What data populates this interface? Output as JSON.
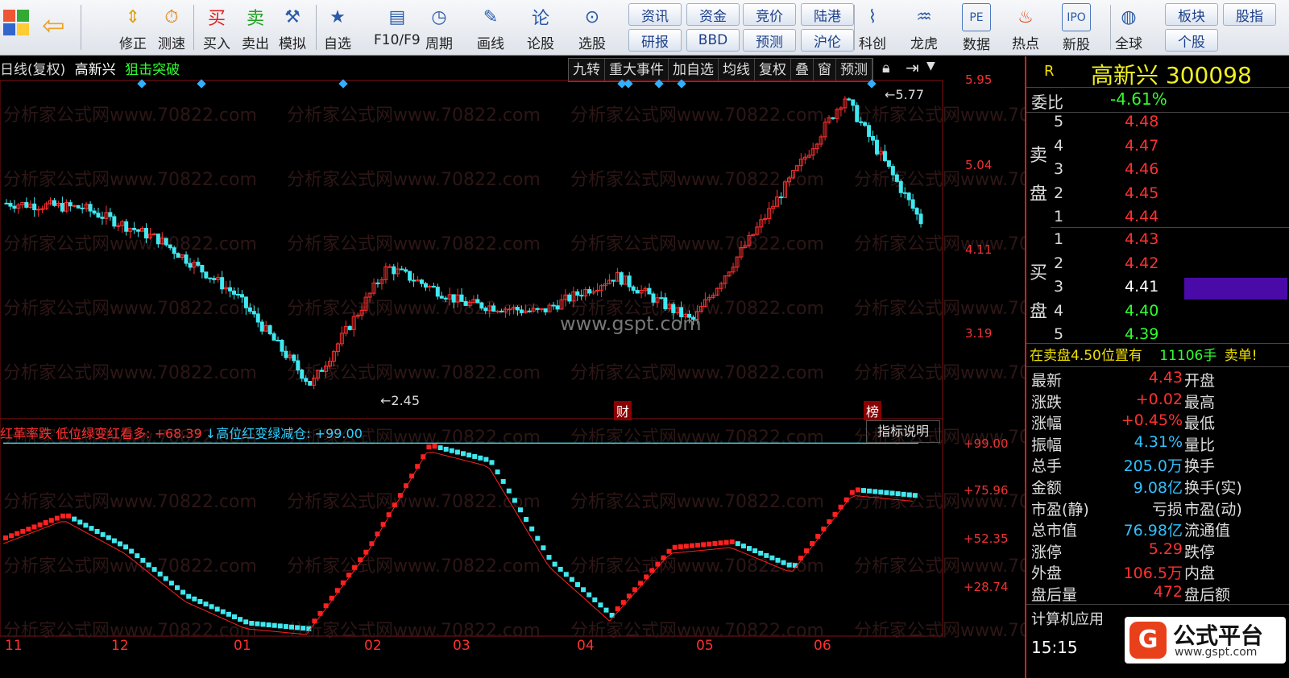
{
  "toolbar": {
    "buttons": [
      {
        "label": "修正",
        "icon": "arrows-updown-icon"
      },
      {
        "label": "测速",
        "icon": "clock-icon"
      },
      {
        "label": "买入",
        "icon": "buy-icon"
      },
      {
        "label": "卖出",
        "icon": "sell-icon"
      },
      {
        "label": "模拟",
        "icon": "hammer-icon"
      },
      {
        "label": "自选",
        "icon": "star-icon"
      },
      {
        "label": "F10/F9",
        "icon": "document-icon"
      },
      {
        "label": "周期",
        "icon": "cycle-icon"
      },
      {
        "label": "画线",
        "icon": "pencil-icon"
      },
      {
        "label": "论股",
        "icon": "discuss-icon"
      },
      {
        "label": "选股",
        "icon": "magnifier-icon"
      },
      {
        "label": "科创",
        "icon": "chart-icon"
      },
      {
        "label": "龙虎",
        "icon": "dragon-icon"
      },
      {
        "label": "数据",
        "icon": "pe-icon"
      },
      {
        "label": "热点",
        "icon": "fire-icon"
      },
      {
        "label": "新股",
        "icon": "ipo-icon"
      },
      {
        "label": "全球",
        "icon": "globe-icon"
      }
    ],
    "pills": [
      "资讯",
      "资金",
      "竞价",
      "陆港",
      "研报",
      "BBD",
      "预测",
      "沪伦",
      "板块",
      "个股",
      "股指"
    ]
  },
  "chart": {
    "header_left": "日线(复权)",
    "stock": "高新兴",
    "signal": "狙击突破",
    "tools": [
      "九转",
      "重大事件",
      "加自选",
      "均线",
      "复权",
      "叠",
      "窗",
      "预测"
    ],
    "price_labels": [
      "5.95",
      "5.04",
      "4.11",
      "3.19"
    ],
    "high_mark": "5.77",
    "low_mark": "2.45",
    "event_marks": [
      "财",
      "榜"
    ],
    "center_watermark": "www.gspt.com",
    "watermark": "分析家公式网www.70822.com"
  },
  "indicator": {
    "formula_text": "红革率跌 低位绿变红看多: +68.39",
    "formula_text2": "↓高位红变绿减仓: +99.00",
    "explain_button": "指标说明",
    "levels": [
      "+99.00",
      "+75.96",
      "+52.35",
      "+28.74"
    ],
    "x_labels": [
      "11",
      "12",
      "01",
      "02",
      "03",
      "04",
      "05",
      "06"
    ]
  },
  "chart_data": {
    "type": "line",
    "title": "高新兴 日线(复权)",
    "xlabel": "",
    "ylabel": "",
    "ylim": [
      2.45,
      5.95
    ],
    "x": [
      "11",
      "12",
      "01",
      "02",
      "03",
      "04",
      "05",
      "06"
    ],
    "series": [
      {
        "values": [
          4.6,
          4.55,
          4.2,
          3.6,
          2.6,
          3.9,
          3.5,
          3.4,
          3.8,
          3.3,
          4.5,
          5.77,
          4.4
        ]
      }
    ],
    "oscillator": {
      "ylim": [
        0,
        100
      ],
      "levels": [
        99.0,
        75.96,
        52.35,
        28.74
      ],
      "current": 68.39
    }
  },
  "side": {
    "flag": "R",
    "name": "高新兴",
    "code": "300098",
    "weibi_label": "委比",
    "weibi": "-4.61%",
    "sell_label": "卖盘",
    "buy_label": "买盘",
    "sell": [
      {
        "lvl": "5",
        "price": "4.48"
      },
      {
        "lvl": "4",
        "price": "4.47"
      },
      {
        "lvl": "3",
        "price": "4.46"
      },
      {
        "lvl": "2",
        "price": "4.45"
      },
      {
        "lvl": "1",
        "price": "4.44"
      }
    ],
    "buy": [
      {
        "lvl": "1",
        "price": "4.43"
      },
      {
        "lvl": "2",
        "price": "4.42"
      },
      {
        "lvl": "3",
        "price": "4.41"
      },
      {
        "lvl": "4",
        "price": "4.40"
      },
      {
        "lvl": "5",
        "price": "4.39"
      }
    ],
    "notice": "在卖盘4.50位置有",
    "notice_qty": "11106手",
    "notice_tail": "卖单!",
    "stats": [
      {
        "k": "最新",
        "v": "4.43",
        "k2": "开盘"
      },
      {
        "k": "涨跌",
        "v": "+0.02",
        "k2": "最高"
      },
      {
        "k": "涨幅",
        "v": "+0.45%",
        "k2": "最低"
      },
      {
        "k": "振幅",
        "v": "4.31%",
        "k2": "量比"
      },
      {
        "k": "总手",
        "v": "205.0万",
        "k2": "换手"
      },
      {
        "k": "金额",
        "v": "9.08亿",
        "k2": "换手(实)"
      },
      {
        "k": "市盈(静)",
        "v": "亏损",
        "k2": "市盈(动)"
      },
      {
        "k": "总市值",
        "v": "76.98亿",
        "k2": "流通值"
      },
      {
        "k": "涨停",
        "v": "5.29",
        "k2": "跌停"
      },
      {
        "k": "外盘",
        "v": "106.5万",
        "k2": "内盘"
      },
      {
        "k": "盘后量",
        "v": "472",
        "k2": "盘后额"
      }
    ],
    "industry": "计算机应用",
    "time": "15:15",
    "brand": "公式平台",
    "brand_url": "www.gspt.com"
  }
}
